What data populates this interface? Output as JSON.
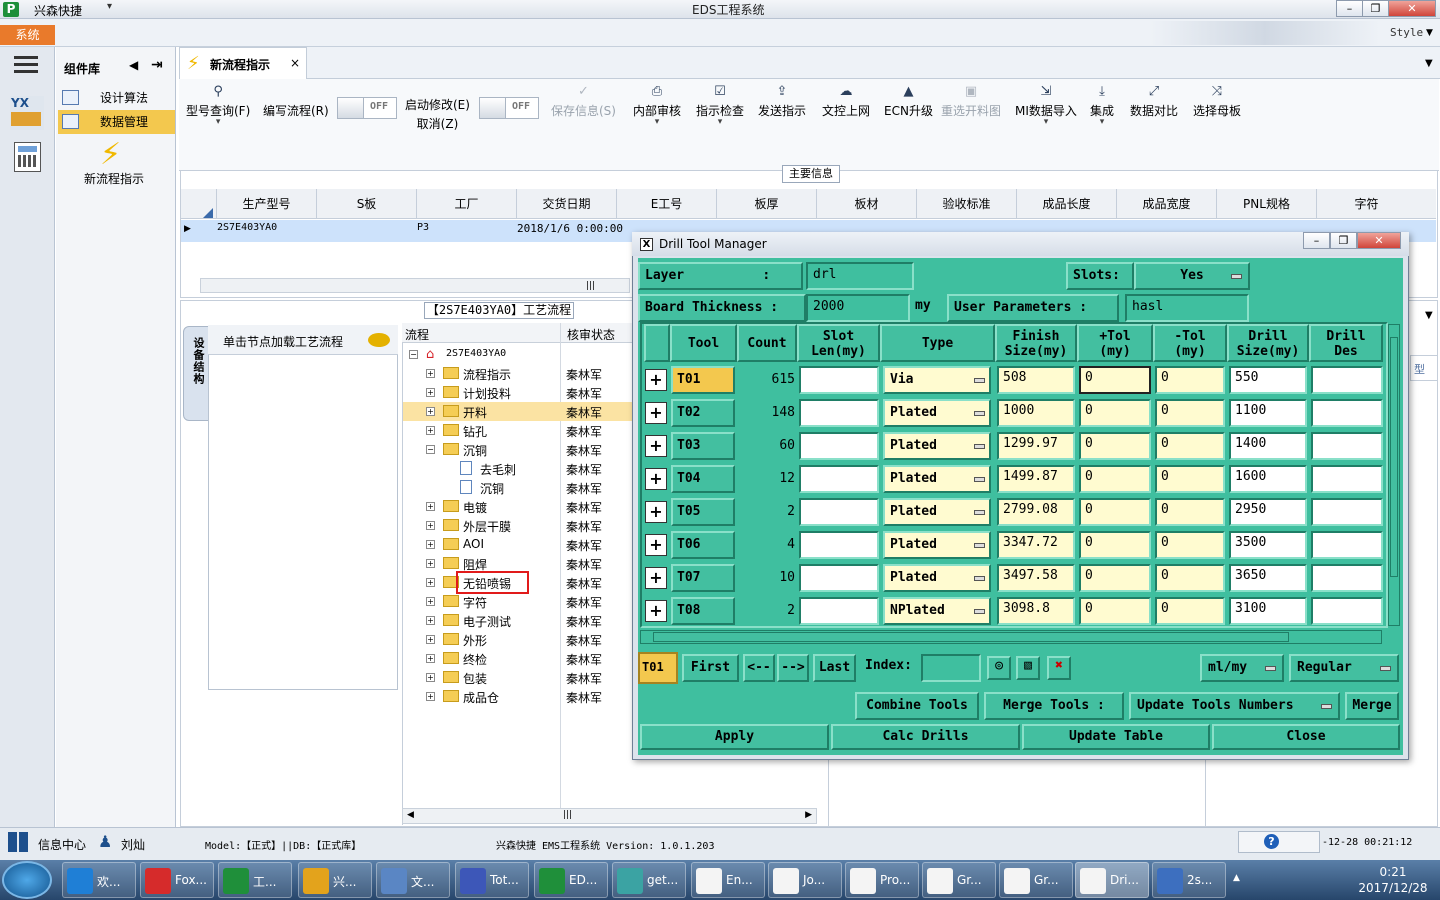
{
  "window": {
    "app_name": "兴森快捷",
    "title": "EDS工程系统",
    "style_label": "Style",
    "system_tab": "系统"
  },
  "sidebar": {
    "header": "组件库",
    "items": [
      {
        "label": "设计算法"
      },
      {
        "label": "数据管理"
      }
    ],
    "new_flow_label": "新流程指示"
  },
  "main_tab": {
    "label": "新流程指示",
    "close": "×"
  },
  "ribbon": {
    "buttons": [
      {
        "label": "型号查询(F)",
        "icon": "search-icon"
      },
      {
        "label": "编写流程(R)",
        "icon": "none"
      },
      {
        "label": "启动修改(E)",
        "label2": "取消(Z)",
        "icon": "none"
      },
      {
        "label": "保存信息(S)",
        "icon": "check-icon"
      },
      {
        "label": "内部审核",
        "icon": "print-icon"
      },
      {
        "label": "指示检查",
        "icon": "checkbox-icon"
      },
      {
        "label": "发送指示",
        "icon": "upload-icon"
      },
      {
        "label": "文控上网",
        "icon": "cloud-upload-icon"
      },
      {
        "label": "ECN升级",
        "icon": "ecn-icon"
      },
      {
        "label": "重选开料图",
        "icon": "image-icon"
      },
      {
        "label": "MI数据导入",
        "icon": "import-icon"
      },
      {
        "label": "集成",
        "icon": "download-icon"
      },
      {
        "label": "数据对比",
        "icon": "compare-icon"
      },
      {
        "label": "选择母板",
        "icon": "shuffle-icon"
      }
    ],
    "toggle_off": "OFF"
  },
  "main_info": {
    "title": "主要信息",
    "columns": [
      "生产型号",
      "S板",
      "工厂",
      "交货日期",
      "E工号",
      "板厚",
      "板材",
      "验收标准",
      "成品长度",
      "成品宽度",
      "PNL规格",
      "字符"
    ],
    "row": {
      "model": "2S7E403YA0",
      "factory": "P3",
      "date": "2018/1/6 0:00:00"
    }
  },
  "flow": {
    "title": "【2S7E403YA0】工艺流程",
    "vtab": "设备结构",
    "load_label": "单击节点加载工艺流程",
    "col_flow": "流程",
    "col_check": "核审状态",
    "root": "2S7E403YA0",
    "nodes": [
      {
        "name": "流程指示",
        "owner": "秦林军",
        "kind": "folder",
        "level": 1
      },
      {
        "name": "计划投料",
        "owner": "秦林军",
        "kind": "folder",
        "level": 1
      },
      {
        "name": "开料",
        "owner": "秦林军",
        "kind": "folder",
        "level": 1
      },
      {
        "name": "钻孔",
        "owner": "秦林军",
        "kind": "folder",
        "level": 1
      },
      {
        "name": "沉铜",
        "owner": "秦林军",
        "kind": "folder",
        "level": 1
      },
      {
        "name": "去毛刺",
        "owner": "秦林军",
        "kind": "page",
        "level": 2
      },
      {
        "name": "沉铜",
        "owner": "秦林军",
        "kind": "page",
        "level": 2
      },
      {
        "name": "电镀",
        "owner": "秦林军",
        "kind": "folder",
        "level": 1
      },
      {
        "name": "外层干膜",
        "owner": "秦林军",
        "kind": "folder",
        "level": 1
      },
      {
        "name": "AOI",
        "owner": "秦林军",
        "kind": "folder",
        "level": 1
      },
      {
        "name": "阻焊",
        "owner": "秦林军",
        "kind": "folder",
        "level": 1
      },
      {
        "name": "无铅喷锡",
        "owner": "秦林军",
        "kind": "folder",
        "level": 1
      },
      {
        "name": "字符",
        "owner": "秦林军",
        "kind": "folder",
        "level": 1
      },
      {
        "name": "电子测试",
        "owner": "秦林军",
        "kind": "folder",
        "level": 1
      },
      {
        "name": "外形",
        "owner": "秦林军",
        "kind": "folder",
        "level": 1
      },
      {
        "name": "终检",
        "owner": "秦林军",
        "kind": "folder",
        "level": 1
      },
      {
        "name": "包装",
        "owner": "秦林军",
        "kind": "folder",
        "level": 1
      },
      {
        "name": "成品仓",
        "owner": "秦林军",
        "kind": "folder",
        "level": 1
      }
    ]
  },
  "dtm": {
    "title": "Drill Tool Manager",
    "layer_label": "Layer          :",
    "layer_value": "drl",
    "slots_label": "Slots:",
    "slots_value": "Yes",
    "thickness_label": "Board Thickness :",
    "thickness_value": "2000",
    "thickness_unit": "my",
    "userparam_label": "User Parameters :",
    "userparam_value": "hasl",
    "headers": [
      "Tool",
      "Count",
      "Slot\nLen(my)",
      "Type",
      "Finish\nSize(my)",
      "+Tol\n(my)",
      "-Tol\n(my)",
      "Drill\nSize(my)",
      "Drill\nDes"
    ],
    "rows": [
      {
        "tool": "T01",
        "count": "615",
        "type": "Via",
        "finish": "508",
        "ptol": "0",
        "ntol": "0",
        "drill": "550"
      },
      {
        "tool": "T02",
        "count": "148",
        "type": "Plated",
        "finish": "1000",
        "ptol": "0",
        "ntol": "0",
        "drill": "1100"
      },
      {
        "tool": "T03",
        "count": "60",
        "type": "Plated",
        "finish": "1299.97",
        "ptol": "0",
        "ntol": "0",
        "drill": "1400"
      },
      {
        "tool": "T04",
        "count": "12",
        "type": "Plated",
        "finish": "1499.87",
        "ptol": "0",
        "ntol": "0",
        "drill": "1600"
      },
      {
        "tool": "T05",
        "count": "2",
        "type": "Plated",
        "finish": "2799.08",
        "ptol": "0",
        "ntol": "0",
        "drill": "2950"
      },
      {
        "tool": "T06",
        "count": "4",
        "type": "Plated",
        "finish": "3347.72",
        "ptol": "0",
        "ntol": "0",
        "drill": "3500"
      },
      {
        "tool": "T07",
        "count": "10",
        "type": "Plated",
        "finish": "3497.58",
        "ptol": "0",
        "ntol": "0",
        "drill": "3650"
      },
      {
        "tool": "T08",
        "count": "2",
        "type": "NPlated",
        "finish": "3098.8",
        "ptol": "0",
        "ntol": "0",
        "drill": "3100"
      }
    ],
    "current_tool": "T01",
    "first": "First",
    "prev": "<--",
    "next": "-->",
    "last": "Last",
    "index_label": "Index:",
    "units": "ml/my",
    "mode": "Regular",
    "combine": "Combine Tools",
    "merge_label": "Merge Tools :",
    "update_numbers": "Update Tools Numbers",
    "merge": "Merge",
    "apply": "Apply",
    "calc": "Calc Drills",
    "update_table": "Update Table",
    "close": "Close"
  },
  "status": {
    "info_center": "信息中心",
    "user": "刘灿",
    "model": "Model:【正式】||DB:【正式库】",
    "version": "兴森快捷 EMS工程系统  Version: 1.0.1.203",
    "tray_time": "-12-28 00:21:12"
  },
  "taskbar": {
    "items": [
      "欢...",
      "Fox...",
      "工...",
      "兴...",
      "文...",
      "Tot...",
      "ED...",
      "get...",
      "En...",
      "Jo...",
      "Pro...",
      "Gr...",
      "Gr...",
      "Dri...",
      "2s..."
    ],
    "time": "0:21",
    "date": "2017/12/28"
  },
  "colors": {
    "accent_orange": "#e97a2b",
    "tk_green": "#3fbf9f",
    "highlight_yellow": "#f3c84e",
    "selected_row": "#cde2fb"
  }
}
